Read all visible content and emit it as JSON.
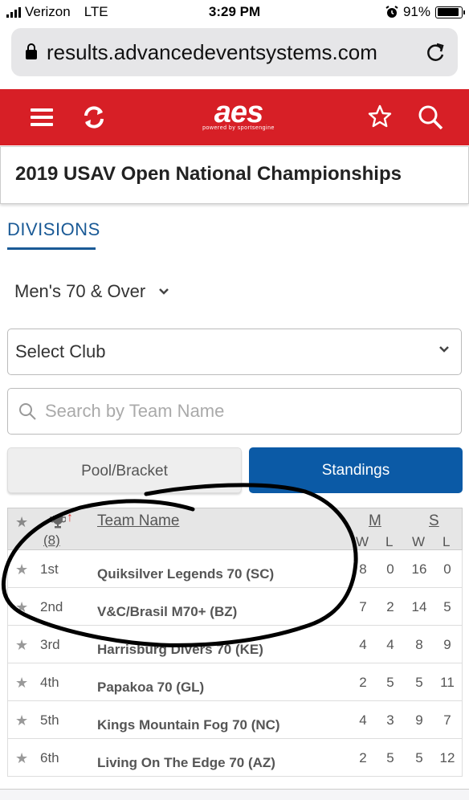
{
  "status_bar": {
    "carrier": "Verizon",
    "network": "LTE",
    "time": "3:29 PM",
    "battery": "91%"
  },
  "browser": {
    "url": "results.advancedeventsystems.com"
  },
  "nav": {
    "logo": "aes",
    "logo_tagline": "powered by sportsengine"
  },
  "event": {
    "title": "2019 USAV Open National Championships"
  },
  "divisions": {
    "tab_label": "DIVISIONS",
    "selected": "Men's 70 & Over"
  },
  "club_select": {
    "value": "Select Club"
  },
  "search": {
    "placeholder": "Search by Team Name"
  },
  "tabs": {
    "pool_bracket": "Pool/Bracket",
    "standings": "Standings",
    "active": "Standings"
  },
  "table": {
    "header": {
      "count": "(8)",
      "team": "Team Name",
      "matches": "M",
      "sets": "S",
      "w": "W",
      "l": "L"
    },
    "rows": [
      {
        "rank": "1st",
        "team": "Quiksilver Legends 70 (SC)",
        "mw": "8",
        "ml": "0",
        "sw": "16",
        "sl": "0"
      },
      {
        "rank": "2nd",
        "team": "V&C/Brasil M70+ (BZ)",
        "mw": "7",
        "ml": "2",
        "sw": "14",
        "sl": "5"
      },
      {
        "rank": "3rd",
        "team": "Harrisburg Divers 70 (KE)",
        "mw": "4",
        "ml": "4",
        "sw": "8",
        "sl": "9"
      },
      {
        "rank": "4th",
        "team": "Papakoa 70 (GL)",
        "mw": "2",
        "ml": "5",
        "sw": "5",
        "sl": "11"
      },
      {
        "rank": "5th",
        "team": "Kings Mountain Fog 70 (NC)",
        "mw": "4",
        "ml": "3",
        "sw": "9",
        "sl": "7"
      },
      {
        "rank": "6th",
        "team": "Living On The Edge 70 (AZ)",
        "mw": "2",
        "ml": "5",
        "sw": "5",
        "sl": "12"
      }
    ]
  },
  "colors": {
    "brand_red": "#d71f26",
    "accent_blue": "#0b5aa6",
    "divisions_blue": "#1a5a96"
  }
}
